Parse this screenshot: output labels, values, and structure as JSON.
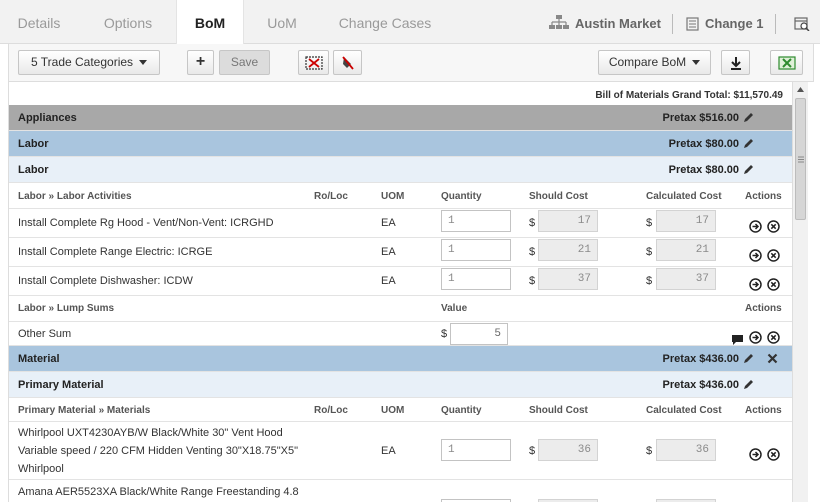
{
  "tabs": {
    "details": "Details",
    "options": "Options",
    "bom": "BoM",
    "uom": "UoM",
    "change_cases": "Change Cases",
    "market": "Austin Market",
    "change": "Change 1"
  },
  "toolbar": {
    "categories": "5 Trade Categories",
    "save": "Save",
    "compare": "Compare BoM"
  },
  "grand_total": "Bill of Materials Grand Total: $11,570.49",
  "cols": {
    "ro_loc": "Ro/Loc",
    "uom": "UOM",
    "quantity": "Quantity",
    "should_cost": "Should Cost",
    "calculated_cost": "Calculated Cost",
    "actions": "Actions",
    "value": "Value"
  },
  "appliances": {
    "title": "Appliances",
    "total": "Pretax $516.00"
  },
  "labor": {
    "title": "Labor",
    "total": "Pretax $80.00",
    "sub_title": "Labor",
    "sub_total": "Pretax $80.00",
    "activities_header": "Labor » Labor Activities",
    "rows": [
      {
        "name": "Install Complete Rg Hood - Vent/Non-Vent: ICRGHD",
        "uom": "EA",
        "qty": "1",
        "cur": "$",
        "should": "17",
        "calc": "17"
      },
      {
        "name": "Install Complete Range Electric: ICRGE",
        "uom": "EA",
        "qty": "1",
        "cur": "$",
        "should": "21",
        "calc": "21"
      },
      {
        "name": "Install Complete Dishwasher: ICDW",
        "uom": "EA",
        "qty": "1",
        "cur": "$",
        "should": "37",
        "calc": "37"
      }
    ],
    "lump_header": "Labor » Lump Sums",
    "lump_row": {
      "name": "Other Sum",
      "cur": "$",
      "value": "5"
    }
  },
  "material": {
    "title": "Material",
    "total": "Pretax $436.00",
    "sub_title": "Primary Material",
    "sub_total": "Pretax $436.00",
    "materials_header": "Primary Material » Materials",
    "rows": [
      {
        "name_l1": "Whirlpool UXT4230AYB/W Black/White 30\" Vent Hood",
        "name_l2": "Variable speed / 220 CFM Hidden Venting 30\"X18.75\"X5\"",
        "name_l3": "Whirlpool",
        "uom": "EA",
        "qty": "1",
        "cur": "$",
        "should": "36",
        "calc": "36"
      },
      {
        "name_l1": "Amana AER5523XA Black/White Range Freestanding 4.8"
      }
    ]
  },
  "colors": {
    "appliances_bar": "#a8a8a8",
    "section_bar": "#a9c5de",
    "subsection_bar": "#e8f0f8",
    "excel_green": "#2e8b2e"
  }
}
